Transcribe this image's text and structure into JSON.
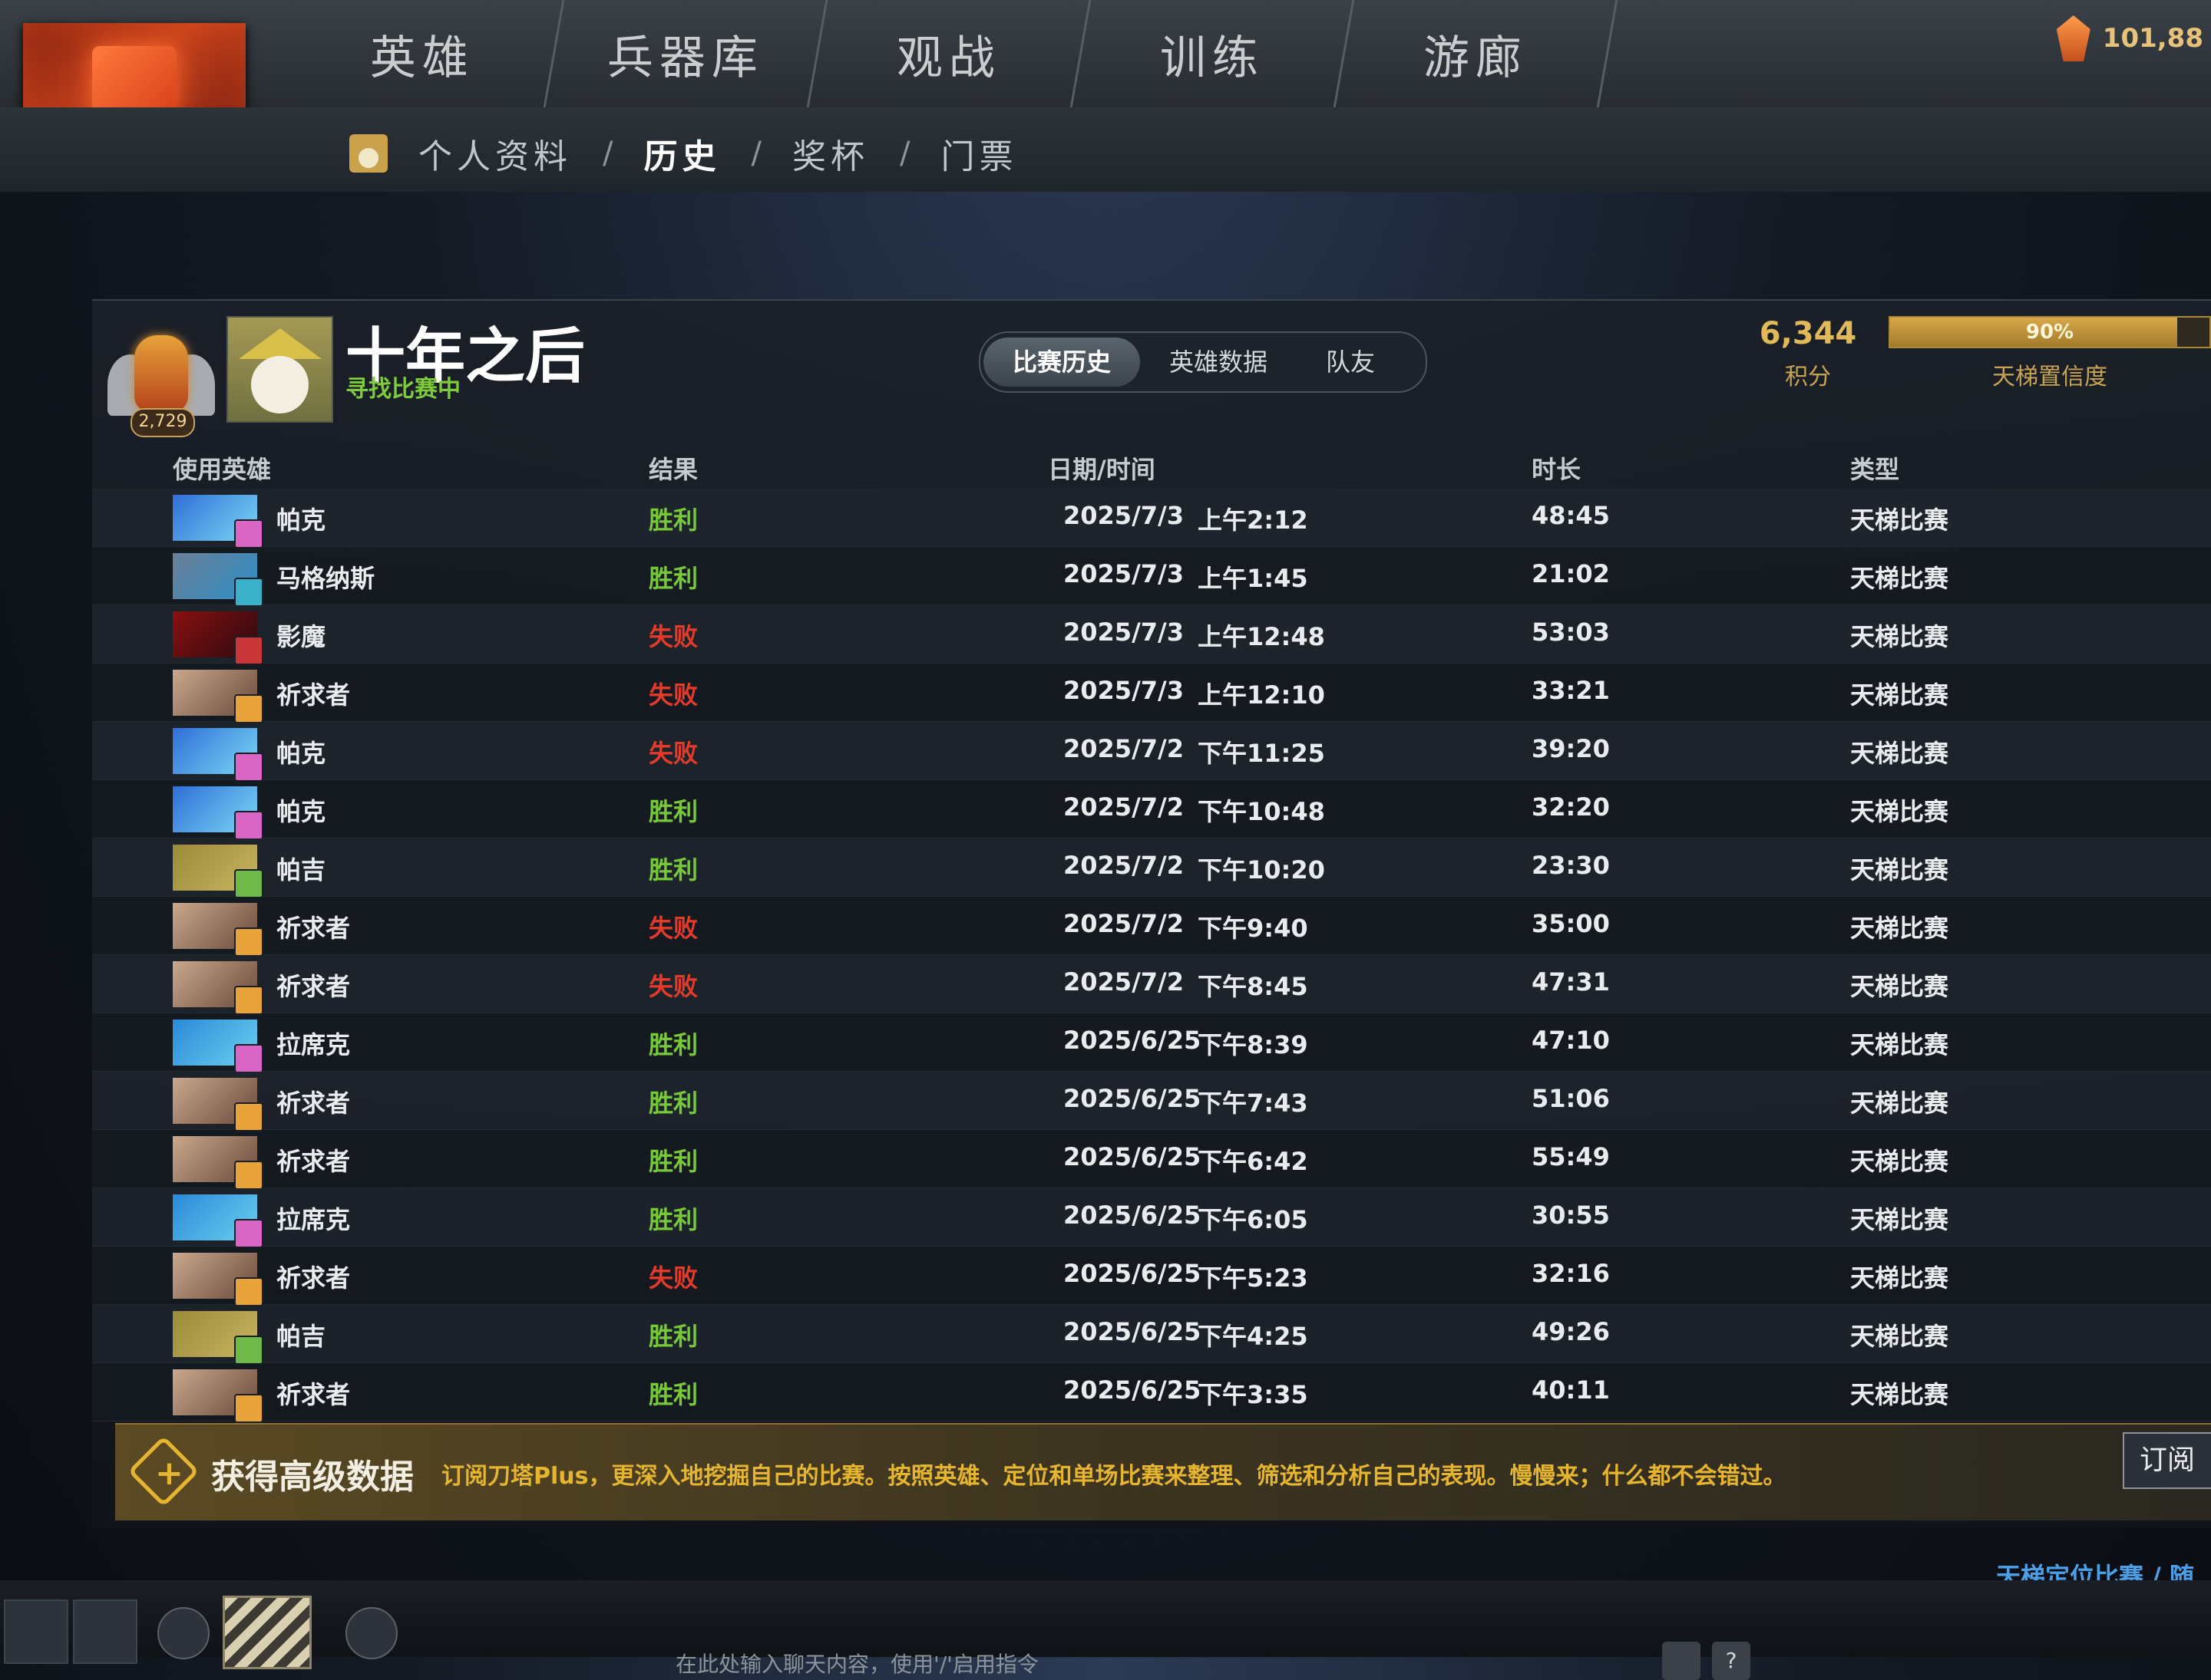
{
  "nav": {
    "tabs": [
      "英雄",
      "兵器库",
      "观战",
      "训练",
      "游廊"
    ],
    "currency": "101,88"
  },
  "subnav": {
    "items": [
      "个人资料",
      "历史",
      "奖杯",
      "门票"
    ],
    "active_index": 1,
    "separator": "/"
  },
  "profile": {
    "rank_number": "2,729",
    "name": "十年之后",
    "status": "寻找比赛中",
    "segment_tabs": [
      "比赛历史",
      "英雄数据",
      "队友"
    ],
    "score_value": "6,344",
    "score_label": "积分",
    "confidence_percent": 90,
    "confidence_text": "90%",
    "confidence_label": "天梯置信度"
  },
  "table": {
    "headers": {
      "hero": "使用英雄",
      "result": "结果",
      "datetime": "日期/时间",
      "duration": "时长",
      "type": "类型"
    },
    "rows": [
      {
        "hero": "帕克",
        "result": "胜利",
        "win": true,
        "date": "2025/7/3",
        "time": "上午2:12",
        "duration": "48:45",
        "type": "天梯比赛"
      },
      {
        "hero": "马格纳斯",
        "result": "胜利",
        "win": true,
        "date": "2025/7/3",
        "time": "上午1:45",
        "duration": "21:02",
        "type": "天梯比赛"
      },
      {
        "hero": "影魔",
        "result": "失败",
        "win": false,
        "date": "2025/7/3",
        "time": "上午12:48",
        "duration": "53:03",
        "type": "天梯比赛"
      },
      {
        "hero": "祈求者",
        "result": "失败",
        "win": false,
        "date": "2025/7/3",
        "time": "上午12:10",
        "duration": "33:21",
        "type": "天梯比赛"
      },
      {
        "hero": "帕克",
        "result": "失败",
        "win": false,
        "date": "2025/7/2",
        "time": "下午11:25",
        "duration": "39:20",
        "type": "天梯比赛"
      },
      {
        "hero": "帕克",
        "result": "胜利",
        "win": true,
        "date": "2025/7/2",
        "time": "下午10:48",
        "duration": "32:20",
        "type": "天梯比赛"
      },
      {
        "hero": "帕吉",
        "result": "胜利",
        "win": true,
        "date": "2025/7/2",
        "time": "下午10:20",
        "duration": "23:30",
        "type": "天梯比赛"
      },
      {
        "hero": "祈求者",
        "result": "失败",
        "win": false,
        "date": "2025/7/2",
        "time": "下午9:40",
        "duration": "35:00",
        "type": "天梯比赛"
      },
      {
        "hero": "祈求者",
        "result": "失败",
        "win": false,
        "date": "2025/7/2",
        "time": "下午8:45",
        "duration": "47:31",
        "type": "天梯比赛"
      },
      {
        "hero": "拉席克",
        "result": "胜利",
        "win": true,
        "date": "2025/6/25",
        "time": "下午8:39",
        "duration": "47:10",
        "type": "天梯比赛"
      },
      {
        "hero": "祈求者",
        "result": "胜利",
        "win": true,
        "date": "2025/6/25",
        "time": "下午7:43",
        "duration": "51:06",
        "type": "天梯比赛"
      },
      {
        "hero": "祈求者",
        "result": "胜利",
        "win": true,
        "date": "2025/6/25",
        "time": "下午6:42",
        "duration": "55:49",
        "type": "天梯比赛"
      },
      {
        "hero": "拉席克",
        "result": "胜利",
        "win": true,
        "date": "2025/6/25",
        "time": "下午6:05",
        "duration": "30:55",
        "type": "天梯比赛"
      },
      {
        "hero": "祈求者",
        "result": "失败",
        "win": false,
        "date": "2025/6/25",
        "time": "下午5:23",
        "duration": "32:16",
        "type": "天梯比赛"
      },
      {
        "hero": "帕吉",
        "result": "胜利",
        "win": true,
        "date": "2025/6/25",
        "time": "下午4:25",
        "duration": "49:26",
        "type": "天梯比赛"
      },
      {
        "hero": "祈求者",
        "result": "胜利",
        "win": true,
        "date": "2025/6/25",
        "time": "下午3:35",
        "duration": "40:11",
        "type": "天梯比赛"
      }
    ]
  },
  "promo": {
    "title": "获得高级数据",
    "description": "订阅刀塔Plus，更深入地挖掘自己的比赛。按照英雄、定位和单场比赛来整理、筛选和分析自己的表现。慢慢来；什么都不会错过。",
    "button": "订阅"
  },
  "bottom": {
    "mode_link": "天梯定位比赛 / 随机",
    "chat_hint": "在此处输入聊天内容，使用'/'启用指令",
    "help_icon": "?"
  },
  "colors": {
    "win": "#78c93a",
    "loss": "#e43a2a",
    "gold": "#e2b958",
    "link": "#4aa0e8"
  },
  "icons": {
    "logo": "dota-logo-icon",
    "currency": "shard-gem-icon",
    "promo": "plus-diamond-icon"
  }
}
